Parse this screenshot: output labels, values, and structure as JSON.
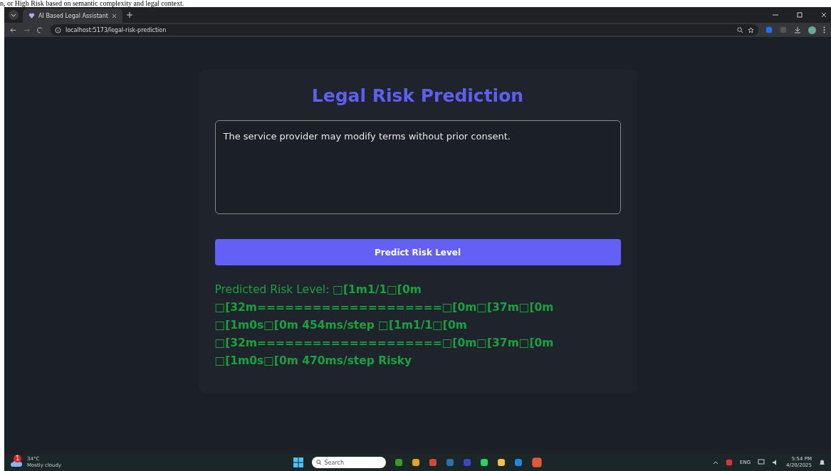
{
  "document_fragment": "n, or High Risk based on semantic complexity and legal context.",
  "browser": {
    "tabs": [
      {
        "title": "AI Based Legal Assistant",
        "selected": true
      }
    ],
    "url": "localhost:5173/legal-risk-prediction"
  },
  "page": {
    "title": "Legal Risk Prediction",
    "input": {
      "value": "The service provider may modify terms without prior consent."
    },
    "button": "Predict Risk Level",
    "result": [
      "Predicted Risk Level: **□[1m1/1□[0m**",
      "**□[32m====================□[0m□[37m□[0m**",
      "**□[1m0s□[0m 454ms/step □[1m1/1□[0m**",
      "**□[32m====================□[0m□[37m□[0m**",
      "**□[1m0s□[0m 470ms/step Risky**"
    ]
  },
  "taskbar": {
    "weather": {
      "temp": "34°C",
      "condition": "Mostly cloudy",
      "badge": "1"
    },
    "search": {
      "placeholder": "Search"
    },
    "language": "ENG",
    "time": "5:54 PM",
    "date": "4/20/2025"
  }
}
